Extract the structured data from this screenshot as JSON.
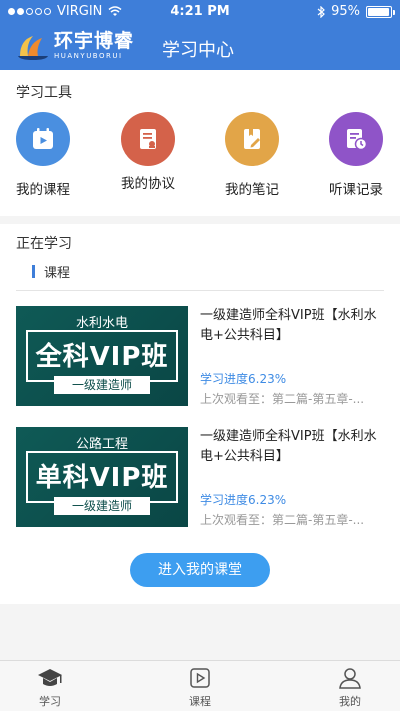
{
  "status_bar": {
    "carrier": "VIRGIN",
    "time": "4:21 PM",
    "battery_percent": "95%",
    "battery_level": 0.95
  },
  "header": {
    "logo_cn": "环宇博睿",
    "logo_en": "HUANYUBORUI",
    "title": "学习中心"
  },
  "tools": {
    "title": "学习工具",
    "items": [
      {
        "label": "我的课程",
        "icon": "play-calendar-icon",
        "color": "#4a8fe0"
      },
      {
        "label": "我的协议",
        "icon": "agreement-icon",
        "color": "#d4624a"
      },
      {
        "label": "我的笔记",
        "icon": "notebook-pen-icon",
        "color": "#e2a548"
      },
      {
        "label": "听课记录",
        "icon": "record-clock-icon",
        "color": "#8f54c8"
      }
    ]
  },
  "learning": {
    "title": "正在学习",
    "tab_label": "课程",
    "courses": [
      {
        "thumb_category": "水利水电",
        "thumb_title": "全科VIP班",
        "thumb_level": "一级建造师",
        "name": "一级建造师全科VIP班【水利水电+公共科目】",
        "progress": "学习进度6.23%",
        "last_watched": "上次观看至：第二篇-第五章-..."
      },
      {
        "thumb_category": "公路工程",
        "thumb_title": "单科VIP班",
        "thumb_level": "一级建造师",
        "name": "一级建造师全科VIP班【水利水电+公共科目】",
        "progress": "学习进度6.23%",
        "last_watched": "上次观看至：第二篇-第五章-..."
      }
    ],
    "enter_button": "进入我的课堂"
  },
  "tabbar": {
    "tabs": [
      {
        "label": "学习",
        "icon": "graduation-cap-icon"
      },
      {
        "label": "课程",
        "icon": "play-card-icon"
      },
      {
        "label": "我的",
        "icon": "user-icon"
      }
    ]
  },
  "colors": {
    "primary": "#3e7ed9",
    "button": "#3d9ef0",
    "progress_text": "#3e8be4"
  }
}
